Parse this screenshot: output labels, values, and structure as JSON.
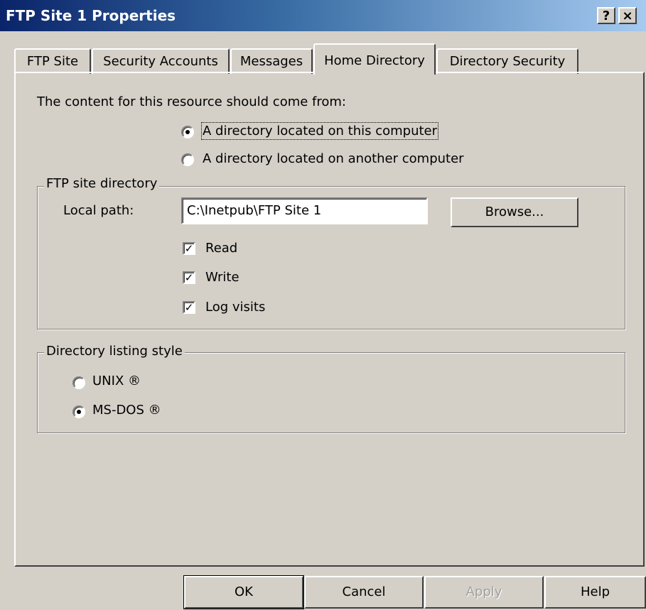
{
  "window": {
    "title": "FTP Site 1 Properties",
    "help_button": "?",
    "close_button": "×"
  },
  "tabs": [
    {
      "label": "FTP Site"
    },
    {
      "label": "Security Accounts"
    },
    {
      "label": "Messages"
    },
    {
      "label": "Home Directory",
      "active": true
    },
    {
      "label": "Directory Security"
    }
  ],
  "content_source": {
    "prompt": "The content for this resource should come from:",
    "options": [
      {
        "label": "A directory located on this computer",
        "selected": true
      },
      {
        "label": "A directory located on another computer",
        "selected": false
      }
    ]
  },
  "ftp_site_directory": {
    "group_title": "FTP site directory",
    "local_path_label": "Local path:",
    "local_path_value": "C:\\Inetpub\\FTP Site 1",
    "browse_label": "Browse...",
    "permissions": [
      {
        "label": "Read",
        "checked": true
      },
      {
        "label": "Write",
        "checked": true
      },
      {
        "label": "Log visits",
        "checked": true
      }
    ]
  },
  "listing_style": {
    "group_title": "Directory listing style",
    "options": [
      {
        "label": "UNIX ®",
        "selected": false
      },
      {
        "label": "MS-DOS ®",
        "selected": true
      }
    ]
  },
  "footer": {
    "ok": "OK",
    "cancel": "Cancel",
    "apply": "Apply",
    "help": "Help"
  },
  "colors": {
    "dialog_background": "#d4d0c8",
    "title_gradient_start": "#0a246a",
    "title_gradient_end": "#a6caf0"
  },
  "icons": {
    "check": "checkmark-icon",
    "radio_dot": "radio-dot-icon"
  }
}
